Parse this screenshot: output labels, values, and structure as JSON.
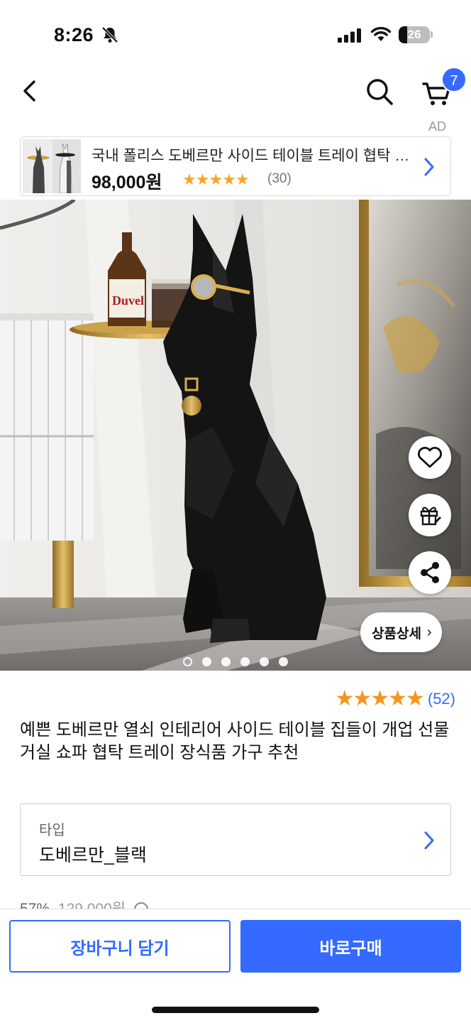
{
  "status_bar": {
    "time": "8:26",
    "battery_level": "26",
    "icons": [
      "bell-slash-icon",
      "cellular-signal-icon",
      "wifi-icon",
      "battery-icon"
    ]
  },
  "nav": {
    "cart_badge": "7",
    "icons": [
      "chevron-left-icon",
      "search-icon",
      "cart-icon"
    ]
  },
  "ad": {
    "label": "AD",
    "title": "국내 폴리스 도베르만 사이드 테이블 트레이 협탁 장식품",
    "price": "98,000원",
    "rating": 4.5,
    "stars_text": "★★★★★",
    "review_count": "(30)"
  },
  "hero": {
    "detail_button": "상품상세",
    "detail_chevron": "›",
    "slide_count": 6,
    "active_slide": 1,
    "side_actions": [
      "heart-icon",
      "gift-icon",
      "share-icon"
    ]
  },
  "product": {
    "rating": 4.5,
    "stars_text": "★★★★★",
    "review_count": "(52)",
    "title": "예쁜 도베르만 열쇠 인테리어 사이드 테이블 집들이 개업 선물 거실 쇼파 협탁 트레이 장식품 가구 추천",
    "option_label": "타입",
    "option_value": "도베르만_블랙",
    "discount": "57%",
    "original_price": "129,000원"
  },
  "bottom_bar": {
    "cart_button": "장바구니 담기",
    "buy_button": "바로구매"
  },
  "colors": {
    "accent": "#346aff",
    "star": "#f7941d",
    "ad_star": "#f5a623"
  }
}
